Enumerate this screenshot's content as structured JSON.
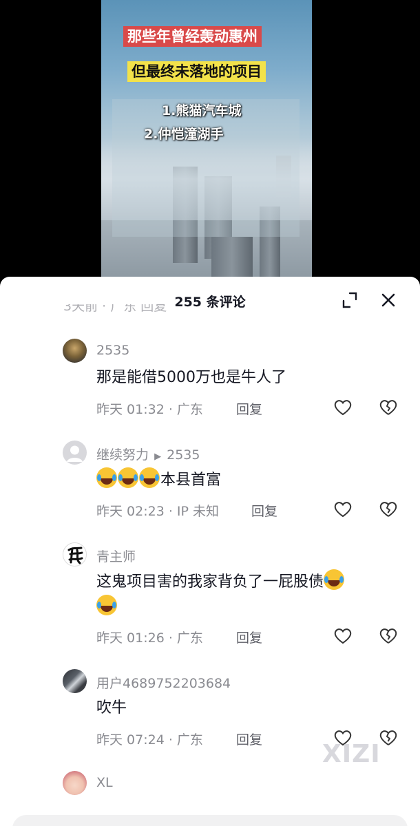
{
  "video": {
    "title_line1": "那些年曾经轰动惠州",
    "title_line2": "但最终未落地的项目",
    "item1": "1.熊猫汽车城",
    "item2": "2.仲恺潼湖手"
  },
  "comments_panel": {
    "title": "255 条评论",
    "partial_row_text": "3天前 · 广东   回复"
  },
  "comments": [
    {
      "username": "2535",
      "text": "那是能借5000万也是牛人了",
      "time": "昨天 01:32",
      "location": "广东",
      "reply_label": "回复",
      "avatar": "figure-avatar"
    },
    {
      "username": "继续努力",
      "reply_to": "2535",
      "emoji_prefix_count": 3,
      "text": "本县首富",
      "time": "昨天 02:23",
      "location": "IP 未知",
      "reply_label": "回复",
      "avatar": "default-avatar"
    },
    {
      "username": "青主师",
      "text": "这鬼项目害的我家背负了一屁股债",
      "time": "昨天 01:26",
      "location": "广东",
      "reply_label": "回复",
      "avatar": "calligraphy-avatar"
    },
    {
      "username": "用户4689752203684",
      "text": "吹牛",
      "time": "昨天 07:24",
      "location": "广东",
      "reply_label": "回复",
      "avatar": "photo-avatar"
    },
    {
      "username": "XL",
      "text": "",
      "avatar": "baby-avatar"
    }
  ],
  "watermark": "XIZI",
  "colors": {
    "title_red": "#d94a4a",
    "title_yellow": "#f3e24a",
    "meta_gray": "#8a8b91",
    "text_dark": "#161823"
  }
}
